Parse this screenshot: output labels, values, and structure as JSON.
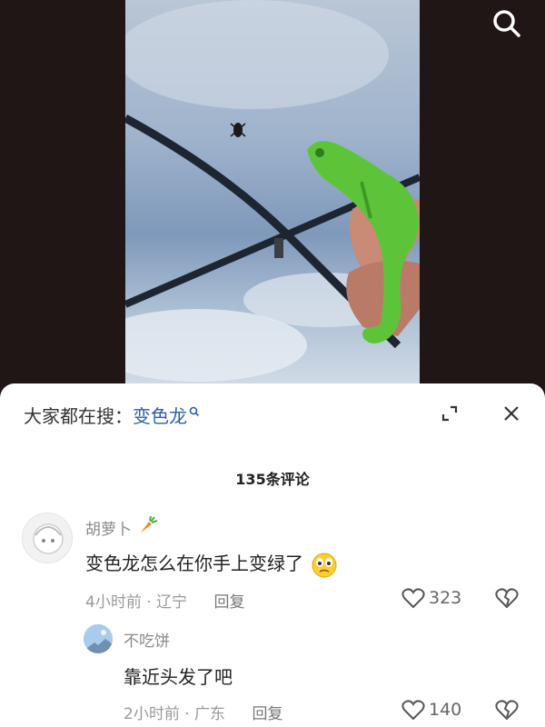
{
  "video": {
    "search_icon": "search-icon"
  },
  "sheet": {
    "hot_search_prefix": "大家都在搜：",
    "hot_search_keyword": "变色龙",
    "comment_count_label": "135条评论"
  },
  "comments": [
    {
      "username": "胡萝卜",
      "username_emoji": "carrot-icon",
      "text": "变色龙怎么在你手上变绿了",
      "text_emoji": "thinking-face-icon",
      "time": "4小时前",
      "location": "辽宁",
      "reply_label": "回复",
      "likes": "323"
    },
    {
      "username": "不吃饼",
      "text": "靠近头发了吧",
      "time": "2小时前",
      "location": "广东",
      "reply_label": "回复",
      "likes": "140"
    }
  ],
  "colors": {
    "keyword": "#2a5ea8",
    "meta": "#9a9a9a",
    "chameleon": "#5dc43a"
  }
}
